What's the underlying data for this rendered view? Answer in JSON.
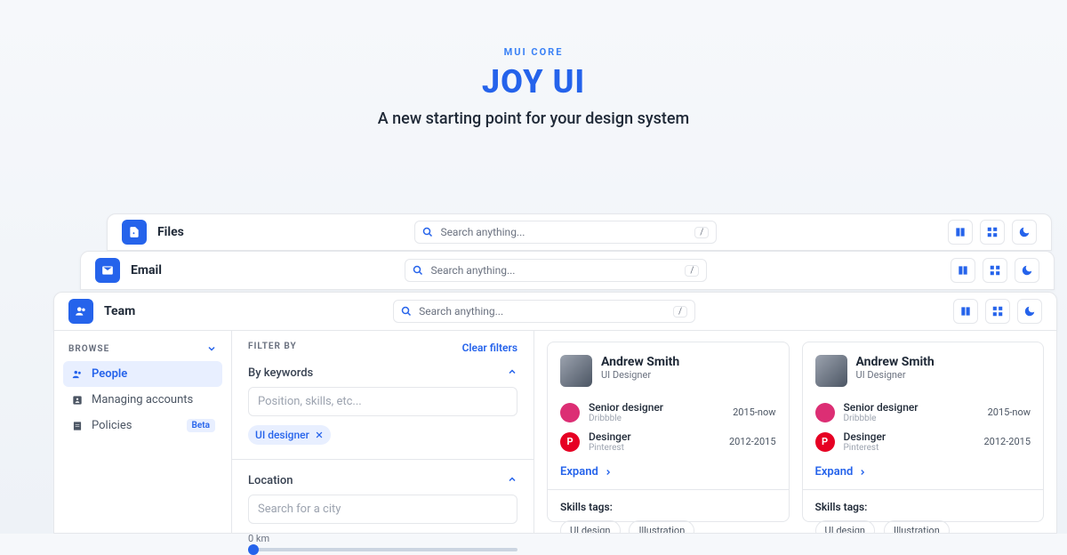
{
  "hero": {
    "eyebrow": "MUI CORE",
    "title": "JOY UI",
    "subtitle": "A new starting point for your design system"
  },
  "apps": {
    "files": {
      "label": "Files",
      "search_placeholder": "Search anything...",
      "kbd": "/"
    },
    "email": {
      "label": "Email",
      "search_placeholder": "Search anything...",
      "kbd": "/"
    },
    "team": {
      "label": "Team",
      "search_placeholder": "Search anything...",
      "kbd": "/"
    }
  },
  "sidebar": {
    "heading": "BROWSE",
    "items": [
      {
        "label": "People",
        "active": true
      },
      {
        "label": "Managing accounts"
      },
      {
        "label": "Policies",
        "badge": "Beta"
      }
    ]
  },
  "filters": {
    "heading": "FILTER BY",
    "clear": "Clear filters",
    "keywords": {
      "label": "By keywords",
      "placeholder": "Position, skills, etc...",
      "chip": "UI designer"
    },
    "location": {
      "label": "Location",
      "placeholder": "Search for a city",
      "slider_label": "0 km"
    }
  },
  "card": {
    "name": "Andrew Smith",
    "role": "UI Designer",
    "jobs": [
      {
        "title": "Senior designer",
        "company": "Dribbble",
        "dates": "2015-now"
      },
      {
        "title": "Desinger",
        "company": "Pinterest",
        "dates": "2012-2015"
      }
    ],
    "expand": "Expand",
    "skills_label": "Skills tags:",
    "tags": [
      "UI design",
      "Illustration"
    ]
  }
}
